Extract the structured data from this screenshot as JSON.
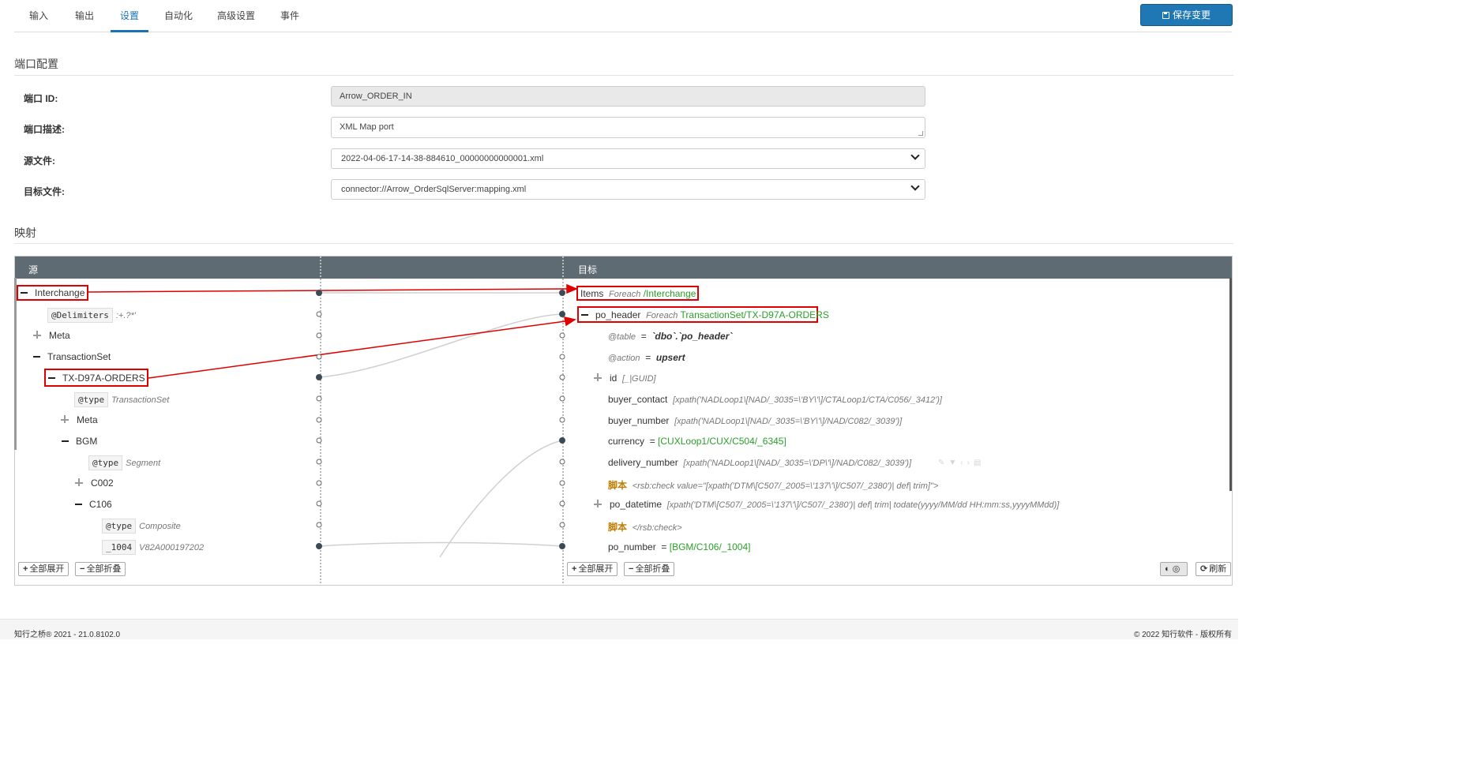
{
  "tabs": [
    "输入",
    "输出",
    "设置",
    "自动化",
    "高级设置",
    "事件"
  ],
  "active_tab": "设置",
  "save_label": "保存变更",
  "port_section": "端口配置",
  "form": {
    "id_label": "端口 ID:",
    "id_value": "Arrow_ORDER_IN",
    "desc_label": "端口描述:",
    "desc_value": "XML Map port",
    "source_label": "源文件:",
    "source_value": "2022-04-06-17-14-38-884610_00000000000001.xml",
    "target_label": "目标文件:",
    "target_value": "connector://Arrow_OrderSqlServer:mapping.xml"
  },
  "mapping_section": "映射",
  "map": {
    "source_header": "源",
    "target_header": "目标",
    "src": {
      "interchange": "Interchange",
      "delimiters": "@Delimiters",
      "delimiters_val": ":+.?*'",
      "meta": "Meta",
      "transactionset": "TransactionSet",
      "tx": "TX-D97A-ORDERS",
      "type1": "@type",
      "type1_val": "TransactionSet",
      "meta2": "Meta",
      "bgm": "BGM",
      "type2": "@type",
      "type2_val": "Segment",
      "c002": "C002",
      "c106": "C106",
      "type3": "@type",
      "type3_val": "Composite",
      "f1004": "_1004",
      "f1004_val": "V82A000197202"
    },
    "tgt": {
      "items": "Items",
      "items_foreach": "Foreach",
      "items_path": "/Interchange",
      "po_header": "po_header",
      "po_header_foreach": "Foreach",
      "po_header_path": "TransactionSet/TX-D97A-ORDERS",
      "table_attr": "@table",
      "table_eq": "=",
      "table_val": "`dbo`.`po_header`",
      "action_attr": "@action",
      "action_eq": "=",
      "action_val": "upsert",
      "id": "id",
      "id_val": "[_|GUID]",
      "buyer_contact": "buyer_contact",
      "buyer_contact_val": "[xpath('NADLoop1\\[NAD/_3035=\\'BY\\'\\]/CTALoop1/CTA/C056/_3412')]",
      "buyer_number": "buyer_number",
      "buyer_number_val": "[xpath('NADLoop1\\[NAD/_3035=\\'BY\\'\\]/NAD/C082/_3039')]",
      "currency": "currency",
      "currency_eq": "=",
      "currency_val": "[CUXLoop1/CUX/C504/_6345]",
      "delivery_number": "delivery_number",
      "delivery_number_val": "[xpath('NADLoop1\\[NAD/_3035=\\'DP\\'\\]/NAD/C082/_3039')]",
      "script1": "脚本",
      "script1_val": "<rsb:check value=\"[xpath('DTM\\[C507/_2005=\\'137\\'\\]/C507/_2380')| def| trim]\">",
      "po_datetime": "po_datetime",
      "po_datetime_val": "[xpath('DTM\\[C507/_2005=\\'137\\'\\]/C507/_2380')| def| trim| todate(yyyy/MM/dd HH:mm:ss,yyyyMMdd)]",
      "script2": "脚本",
      "script2_val": "</rsb:check>",
      "po_number": "po_number",
      "po_number_eq": "=",
      "po_number_val": "[BGM/C106/_1004]"
    },
    "expand_all": "全部展开",
    "collapse_all": "全部折叠",
    "refresh": "刷新"
  },
  "footer": {
    "left": "知行之桥® 2021 - 21.0.8102.0",
    "right": "© 2022 知行软件 - 版权所有"
  },
  "colors": {
    "accent": "#1f78b4",
    "highlight": "#e00000",
    "green": "#2aa02a",
    "header": "#5f6b73"
  }
}
